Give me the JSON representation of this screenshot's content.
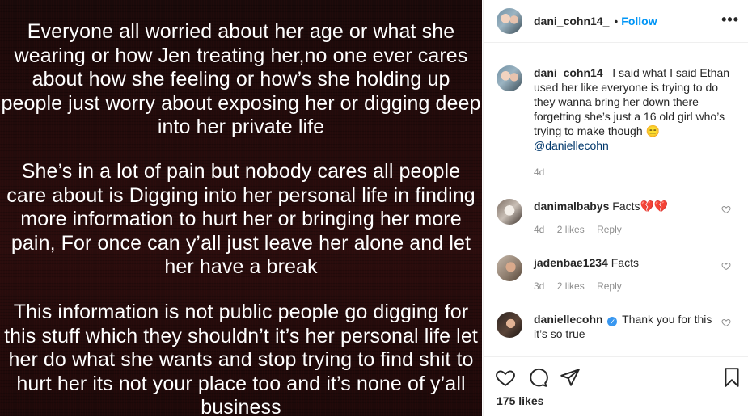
{
  "post_image": {
    "paragraph_1": "Everyone all worried about her age or what she wearing or how Jen treating her,no one ever cares about how she feeling or how’s she holding up people just worry about exposing her or digging deep into her private life",
    "paragraph_2": "She’s in a lot of pain but nobody cares all people care about is Digging into her personal life in finding more information to hurt her or bringing her more pain, For once can y’all just leave her alone and let her have a break",
    "paragraph_3": "This information is not public people go digging for this stuff which they shouldn’t it’s her personal life let her do what she wants and stop trying to find shit to hurt her its not your place too and it’s none of y’all business"
  },
  "header": {
    "username": "dani_cohn14_",
    "separator": "•",
    "follow_label": "Follow",
    "more_icon": "•••"
  },
  "caption": {
    "username": "dani_cohn14_",
    "text": "I said what I said Ethan used her like everyone is trying to do they wanna bring her down there forgetting she’s just a 16 old girl who’s trying to make though 😑",
    "mention": "@daniellecohn",
    "time": "4d"
  },
  "comments": [
    {
      "username": "danimalbabys",
      "text": "Facts",
      "emoji": "💔💔",
      "time": "4d",
      "likes": "2 likes",
      "reply": "Reply"
    },
    {
      "username": "jadenbae1234",
      "text": "Facts",
      "time": "3d",
      "likes": "2 likes",
      "reply": "Reply"
    },
    {
      "username": "daniellecohn",
      "verified": "✓",
      "text": "Thank you for this it’s so true"
    }
  ],
  "actions": {
    "likes": "175 likes"
  },
  "colors": {
    "link": "#0095f6",
    "text": "#262626",
    "muted": "#8e8e8e",
    "mention": "#00376b"
  }
}
